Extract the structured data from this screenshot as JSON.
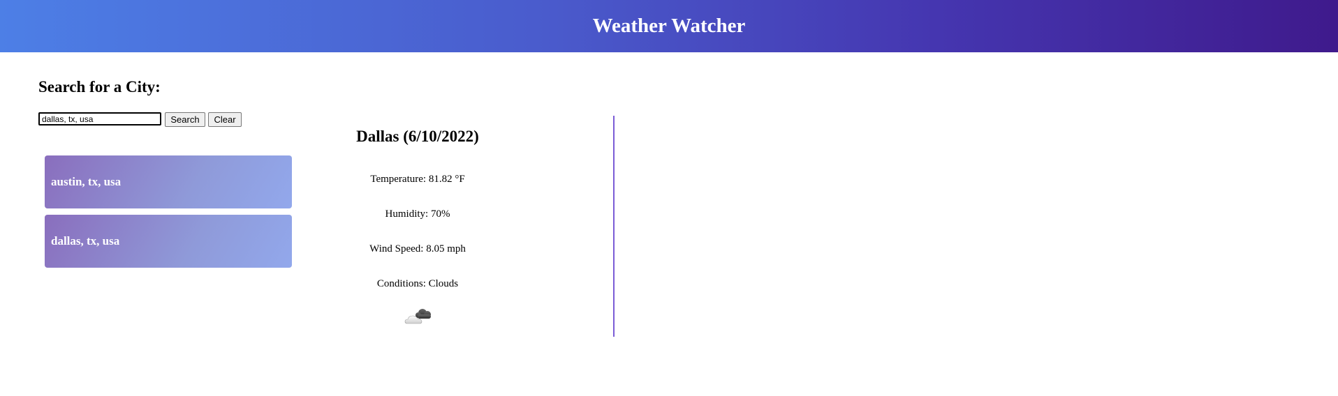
{
  "header": {
    "title": "Weather Watcher"
  },
  "search": {
    "heading": "Search for a City:",
    "input_value": "dallas, tx, usa",
    "search_label": "Search",
    "clear_label": "Clear"
  },
  "history": {
    "items": [
      {
        "label": "austin, tx, usa"
      },
      {
        "label": "dallas, tx, usa"
      }
    ]
  },
  "current": {
    "title": "Dallas (6/10/2022)",
    "temperature": "Temperature: 81.82 °F",
    "humidity": "Humidity: 70%",
    "wind": "Wind Speed: 8.05 mph",
    "conditions": "Conditions: Clouds",
    "icon": "clouds-icon"
  },
  "colors": {
    "header_start": "#4d7fe6",
    "header_end": "#3f1a8c",
    "history_start": "#8a6ebd",
    "history_end": "#92a8ec",
    "divider": "#7b5cd6"
  }
}
